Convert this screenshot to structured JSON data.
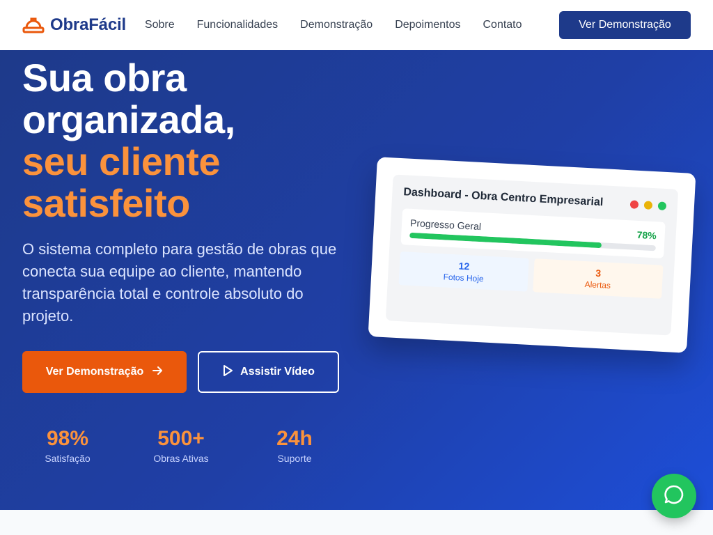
{
  "header": {
    "logo_text": "ObraFácil",
    "logo_icon": "hard-hat-icon",
    "nav": [
      "Sobre",
      "Funcionalidades",
      "Demonstração",
      "Depoimentos",
      "Contato"
    ],
    "cta_label": "Ver Demonstração"
  },
  "hero": {
    "title_line1": "Sua obra",
    "title_line2": "organizada,",
    "title_accent1": "seu cliente",
    "title_accent2": "satisfeito",
    "subtitle": "O sistema completo para gestão de obras que conecta sua equipe ao cliente, mantendo transparência total e controle absoluto do projeto.",
    "primary_button": "Ver Demonstração",
    "secondary_button": "Assistir Vídeo",
    "stats": [
      {
        "value": "98%",
        "label": "Satisfação"
      },
      {
        "value": "500+",
        "label": "Obras Ativas"
      },
      {
        "value": "24h",
        "label": "Suporte"
      }
    ]
  },
  "dashboard": {
    "title": "Dashboard - Obra Centro Empresarial",
    "progress_label": "Progresso Geral",
    "progress_value": "78%",
    "progress_fraction": 0.78,
    "photos_value": "12",
    "photos_label": "Fotos Hoje",
    "alerts_value": "3",
    "alerts_label": "Alertas",
    "dot_colors": [
      "#ef4444",
      "#eab308",
      "#22c55e"
    ]
  },
  "colors": {
    "brand_blue": "#1e3a8a",
    "accent_orange": "#ea580c",
    "accent_orange_text": "#fb923c",
    "whatsapp_green": "#22c55e"
  },
  "floating": {
    "icon": "chat-bubble-icon"
  }
}
